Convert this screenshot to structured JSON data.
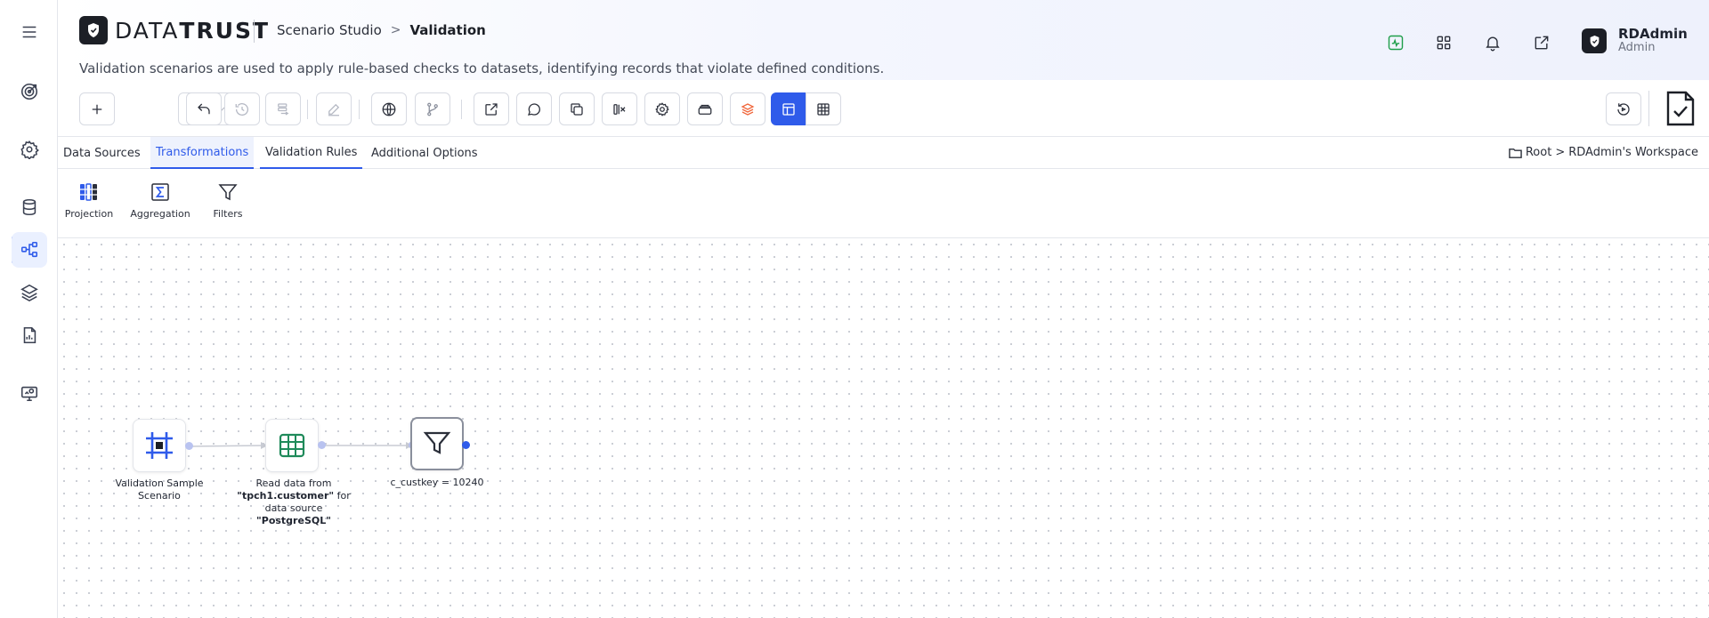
{
  "header": {
    "brand_light": "DATA",
    "brand_bold": "TRUST",
    "breadcrumb_parent": "Scenario Studio",
    "breadcrumb_separator": ">",
    "breadcrumb_current": "Validation",
    "subtitle": "Validation scenarios are used to apply rule-based checks to datasets, identifying records that violate defined conditions.",
    "icons": [
      "activity-icon",
      "apps-grid-icon",
      "bell-icon",
      "external-link-icon",
      "help-icon"
    ],
    "user": {
      "name": "RDAdmin",
      "role": "Admin"
    }
  },
  "sidebar": {
    "items": [
      "menu-icon",
      "target-icon",
      "settings-icon",
      "database-icon",
      "workflow-icon",
      "layers-icon",
      "report-icon",
      "monitor-icon"
    ],
    "active": "workflow-icon"
  },
  "tabs": {
    "items": [
      {
        "label": "Data Sources"
      },
      {
        "label": "Transformations"
      },
      {
        "label": "Validation Rules"
      },
      {
        "label": "Additional Options"
      }
    ],
    "active": "Transformations",
    "workspace_root": "Root",
    "workspace_separator": ">",
    "workspace_name": "RDAdmin's Workspace"
  },
  "palette": {
    "items": [
      {
        "label": "Projection"
      },
      {
        "label": "Aggregation"
      },
      {
        "label": "Filters"
      }
    ]
  },
  "canvas": {
    "nodes": [
      {
        "label": "Validation Sample Scenario"
      },
      {
        "label_prefix": "Read data from ",
        "table": "\"tpch1.customer\"",
        "label_mid": " for data source ",
        "source": "\"PostgreSQL\""
      },
      {
        "label": "c_custkey = 10240"
      }
    ]
  },
  "colors": {
    "accent": "#2f5bea",
    "dark": "#1c1f26",
    "success": "#1e9e4a",
    "layers_orange": "#f0673c"
  }
}
